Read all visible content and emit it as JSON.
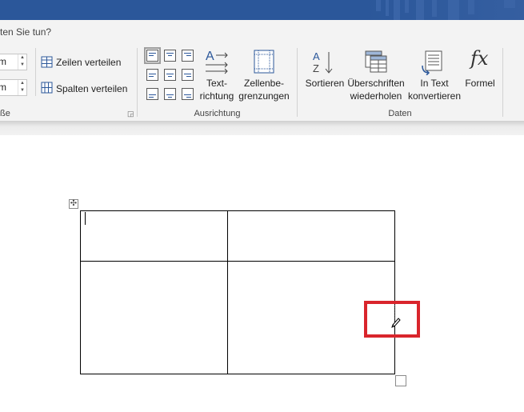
{
  "tell_me": {
    "text": "ten Sie tun?"
  },
  "ribbon": {
    "cell_size": {
      "height_value": "m",
      "width_value": "m",
      "distribute_rows_label": "Zeilen verteilen",
      "distribute_columns_label": "Spalten verteilen",
      "group_label": "ße"
    },
    "alignment": {
      "text_direction_label_1": "Text-",
      "text_direction_label_2": "richtung",
      "cell_margins_label_1": "Zellenbe-",
      "cell_margins_label_2": "grenzungen",
      "group_label": "Ausrichtung"
    },
    "data": {
      "sort_label": "Sortieren",
      "repeat_headers_label_1": "Überschriften",
      "repeat_headers_label_2": "wiederholen",
      "convert_label_1": "In Text",
      "convert_label_2": "konvertieren",
      "formula_label": "Formel",
      "formula_icon_text": "fx",
      "sort_icon_a": "A",
      "sort_icon_z": "Z",
      "text_dir_icon": "A",
      "group_label": "Daten"
    }
  },
  "document": {
    "table": {
      "rows": 2,
      "columns": 2
    },
    "move_handle_glyph": "✣"
  },
  "colors": {
    "title_bar": "#2b579a",
    "ribbon_bg": "#f3f3f3",
    "highlight": "#d9252c",
    "icon_accent": "#2b579a"
  }
}
